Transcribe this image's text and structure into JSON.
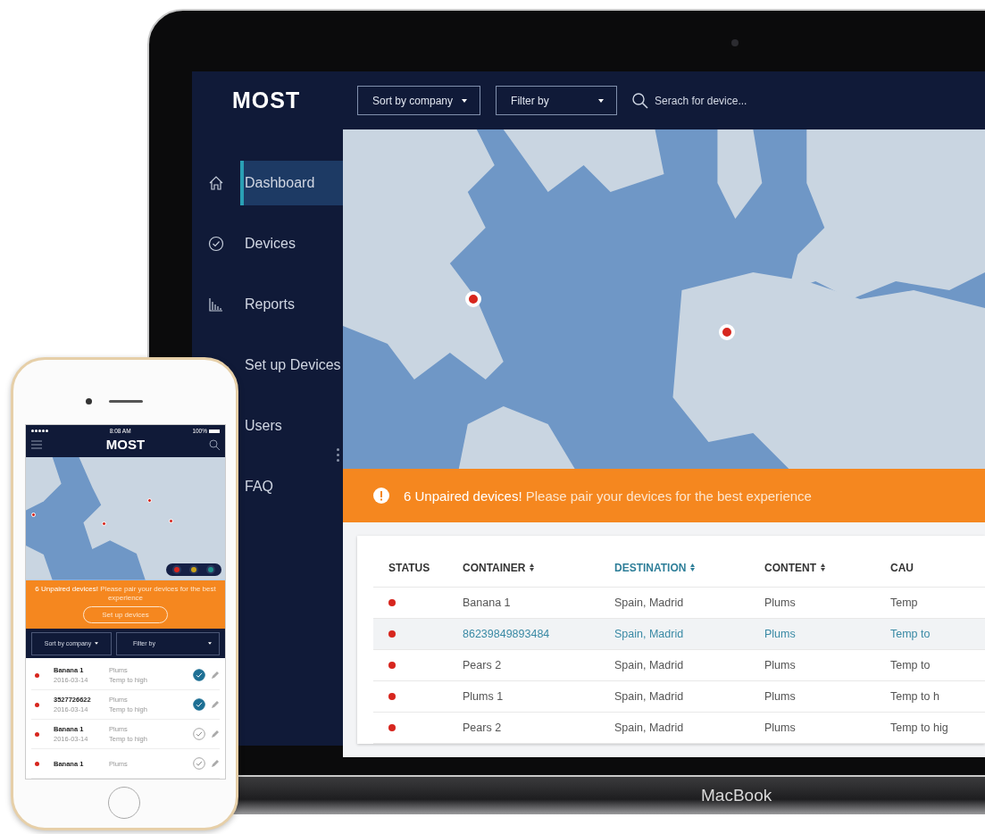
{
  "laptop": {
    "brand": "MacBook",
    "app": {
      "logo": "MOST",
      "sort_dropdown": "Sort by company",
      "filter_dropdown": "Filter by",
      "search": {
        "placeholder": "Serach for device..."
      },
      "sidebar": {
        "items": [
          {
            "label": "Dashboard",
            "selected": true
          },
          {
            "label": "Devices",
            "selected": false
          },
          {
            "label": "Reports",
            "selected": false
          },
          {
            "label": "Set up Devices",
            "selected": false
          },
          {
            "label": "Users",
            "selected": false
          },
          {
            "label": "FAQ",
            "selected": false
          }
        ]
      },
      "banner": {
        "message": "**6 Unpaired devices!** Please pair your devices for the best experience"
      },
      "table": {
        "columns": [
          {
            "label": "STATUS",
            "sortable": false,
            "selected": false
          },
          {
            "label": "CONTAINER",
            "sortable": true,
            "selected": false
          },
          {
            "label": "DESTINATION",
            "sortable": true,
            "selected": true
          },
          {
            "label": "CONTENT",
            "sortable": true,
            "selected": false
          },
          {
            "label": "CAU",
            "sortable": false,
            "selected": false
          }
        ],
        "rows": [
          {
            "selected": false,
            "cells": [
              "",
              "Banana 1",
              "Spain, Madrid",
              "Plums",
              "Temp"
            ]
          },
          {
            "selected": true,
            "cells": [
              "",
              "86239849893484",
              "Spain, Madrid",
              "Plums",
              "Temp to"
            ]
          },
          {
            "selected": false,
            "cells": [
              "",
              "Pears 2",
              "Spain, Madrid",
              "Plums",
              "Temp to"
            ]
          },
          {
            "selected": false,
            "cells": [
              "",
              "Plums 1",
              "Spain, Madrid",
              "Plums",
              "Temp to h"
            ]
          },
          {
            "selected": false,
            "cells": [
              "",
              "Pears 2",
              "Spain, Madrid",
              "Plums",
              "Temp to hig"
            ]
          }
        ]
      }
    }
  },
  "phone": {
    "time": "8:08 AM",
    "battery": "100%",
    "title": "MOST",
    "legend": [
      {
        "color": "#d7261e"
      },
      {
        "color": "#c9a21a"
      },
      {
        "color": "#1f8f8a"
      }
    ],
    "banner": {
      "message": "**6 Unpaired devices!** Please pair your devices for the best experience",
      "button": "Set up devices"
    },
    "sort_dropdown": "Sort by company",
    "filter_dropdown": "Filter by",
    "items": [
      {
        "name": "Banana 1",
        "date": "2016-03-14",
        "content": "Plums",
        "cause": "Temp to high",
        "checked": true
      },
      {
        "name": "3527726622",
        "date": "2016-03-14",
        "content": "Plums",
        "cause": "Temp to high",
        "checked": true
      },
      {
        "name": "Banana 1",
        "date": "2016-03-14",
        "content": "Plums",
        "cause": "Temp to high",
        "checked": false
      },
      {
        "name": "Banana 1",
        "content": "Plums",
        "checked": false
      }
    ]
  }
}
